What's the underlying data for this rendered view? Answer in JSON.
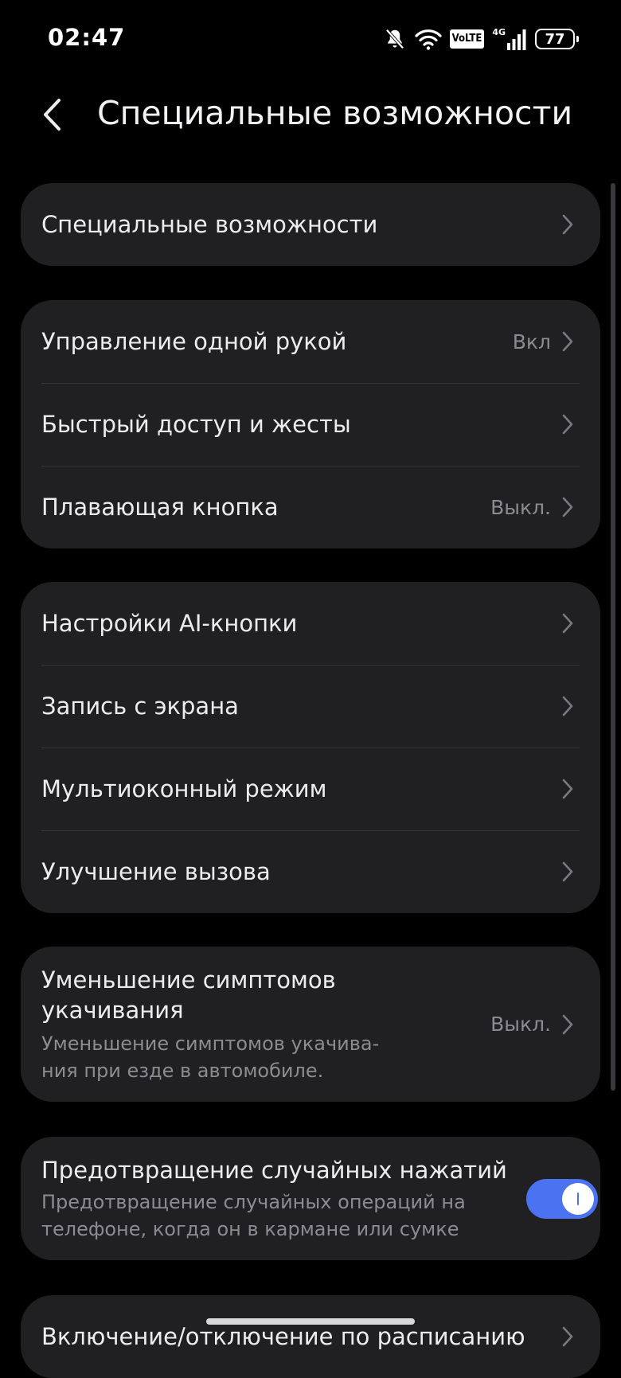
{
  "status_bar": {
    "time": "02:47",
    "volte": "VoLTE",
    "network": "4G",
    "battery": "77"
  },
  "header": {
    "title": "Специальные возможности"
  },
  "groups": [
    {
      "items": [
        {
          "label": "Специальные возможности",
          "value": ""
        }
      ]
    },
    {
      "items": [
        {
          "label": "Управление одной рукой",
          "value": "Вкл"
        },
        {
          "label": "Быстрый доступ и жесты",
          "value": ""
        },
        {
          "label": "Плавающая кнопка",
          "value": "Выкл."
        }
      ]
    },
    {
      "items": [
        {
          "label": "Настройки AI-кнопки",
          "value": ""
        },
        {
          "label": "Запись с экрана",
          "value": ""
        },
        {
          "label": "Мультиоконный режим",
          "value": ""
        },
        {
          "label": "Улучшение вызова",
          "value": ""
        }
      ]
    }
  ],
  "motion_sickness": {
    "title_line1": "Уменьшение симптомов",
    "title_line2": "укачивания",
    "subtitle_line1": "Уменьшение симптомов укачива-",
    "subtitle_line2": "ния при езде в автомобиле.",
    "value": "Выкл."
  },
  "accidental_touch": {
    "title": "Предотвращение случайных нажатий",
    "subtitle_line1": "Предотвращение случайных операций на",
    "subtitle_line2": "телефоне, когда он в кармане или сумке",
    "enabled": true
  },
  "schedule": {
    "title": "Включение/отключение по расписанию"
  },
  "colors": {
    "background": "#000000",
    "card": "#202022",
    "accent": "#4b72f0",
    "secondary_text": "#8b8b90"
  }
}
